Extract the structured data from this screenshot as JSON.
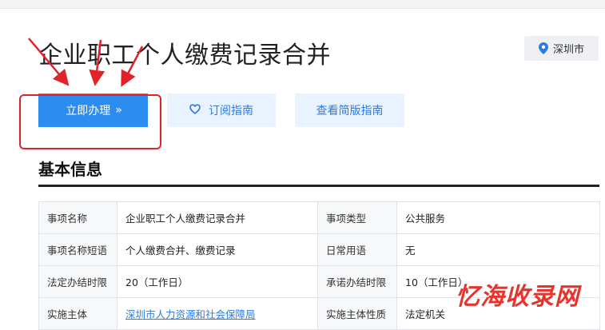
{
  "page": {
    "title": "企业职工个人缴费记录合并",
    "city": "深圳市"
  },
  "actions": {
    "apply_label": "立即办理",
    "apply_chevron": "»",
    "subscribe_label": "订阅指南",
    "brief_label": "查看简版指南"
  },
  "section": {
    "title": "基本信息"
  },
  "table": {
    "rows": [
      [
        "事项名称",
        "企业职工个人缴费记录合并",
        "事项类型",
        "公共服务"
      ],
      [
        "事项名称短语",
        "个人缴费合并、缴费记录",
        "日常用语",
        "无"
      ],
      [
        "法定办结时限",
        "20（工作日）",
        "承诺办结时限",
        "10（工作日）"
      ],
      [
        "实施主体",
        "深圳市人力资源和社会保障局",
        "实施主体性质",
        "法定机关"
      ]
    ]
  },
  "watermark": "忆海收录网",
  "colors": {
    "primary": "#2d8cf0",
    "light_button": "#e8f3ff",
    "annotation": "#e0222a"
  },
  "icons": {
    "city": "location-pin-icon",
    "subscribe": "heart-icon",
    "apply": "double-chevron-right-icon"
  }
}
